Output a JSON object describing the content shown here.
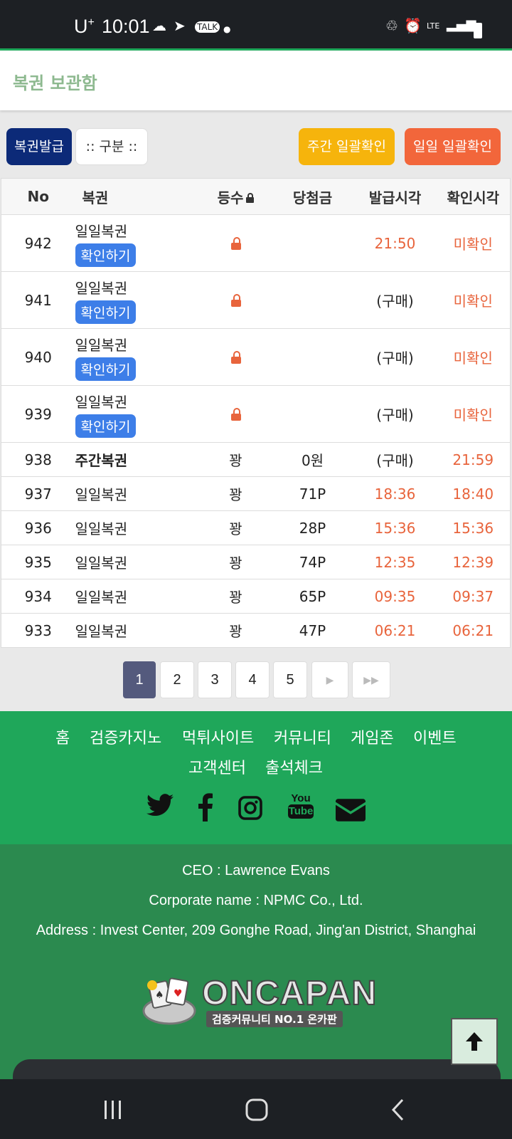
{
  "status": {
    "carrier": "U",
    "carrier_sup": "+",
    "time": "10:01"
  },
  "header": {
    "title": "복권 보관함"
  },
  "buttons": {
    "issue": "복권발급",
    "category": ":: 구분 ::",
    "weekly_check": "주간 일괄확인",
    "daily_check": "일일 일괄확인"
  },
  "table": {
    "headers": {
      "no": "No",
      "ticket": "복권",
      "rank": "등수",
      "prize": "당첨금",
      "issued": "발급시각",
      "checked": "확인시각"
    },
    "check_button": "확인하기",
    "rows": [
      {
        "no": "942",
        "ticket": "일일복권",
        "rank": "",
        "prize": "",
        "issued": "21:50",
        "checked": "미확인"
      },
      {
        "no": "941",
        "ticket": "일일복권",
        "rank": "",
        "prize": "",
        "issued": "(구매)",
        "checked": "미확인"
      },
      {
        "no": "940",
        "ticket": "일일복권",
        "rank": "",
        "prize": "",
        "issued": "(구매)",
        "checked": "미확인"
      },
      {
        "no": "939",
        "ticket": "일일복권",
        "rank": "",
        "prize": "",
        "issued": "(구매)",
        "checked": "미확인"
      },
      {
        "no": "938",
        "ticket": "주간복권",
        "rank": "꽝",
        "prize": "0원",
        "issued": "(구매)",
        "checked": "21:59"
      },
      {
        "no": "937",
        "ticket": "일일복권",
        "rank": "꽝",
        "prize": "71P",
        "issued": "18:36",
        "checked": "18:40"
      },
      {
        "no": "936",
        "ticket": "일일복권",
        "rank": "꽝",
        "prize": "28P",
        "issued": "15:36",
        "checked": "15:36"
      },
      {
        "no": "935",
        "ticket": "일일복권",
        "rank": "꽝",
        "prize": "74P",
        "issued": "12:35",
        "checked": "12:39"
      },
      {
        "no": "934",
        "ticket": "일일복권",
        "rank": "꽝",
        "prize": "65P",
        "issued": "09:35",
        "checked": "09:37"
      },
      {
        "no": "933",
        "ticket": "일일복권",
        "rank": "꽝",
        "prize": "47P",
        "issued": "06:21",
        "checked": "06:21"
      }
    ]
  },
  "pagination": {
    "pages": [
      "1",
      "2",
      "3",
      "4",
      "5"
    ],
    "current": "1"
  },
  "footer_nav": [
    "홈",
    "검증카지노",
    "먹튀사이트",
    "커뮤니티",
    "게임존",
    "이벤트",
    "고객센터",
    "출석체크"
  ],
  "footer_info": {
    "ceo": "CEO : Lawrence Evans",
    "corp": "Corporate name : NPMC Co., Ltd.",
    "address": "Address : Invest Center, 209 Gonghe Road, Jing'an District, Shanghai"
  },
  "logo": {
    "name": "ONCAPAN",
    "tagline": "검증커뮤니티 NO.1 온카판"
  },
  "colors": {
    "accent_green": "#1fa75a",
    "issue_blue": "#0c2a78",
    "weekly_yellow": "#f6b40c",
    "daily_orange": "#f2663b",
    "red_text": "#e8643c"
  }
}
